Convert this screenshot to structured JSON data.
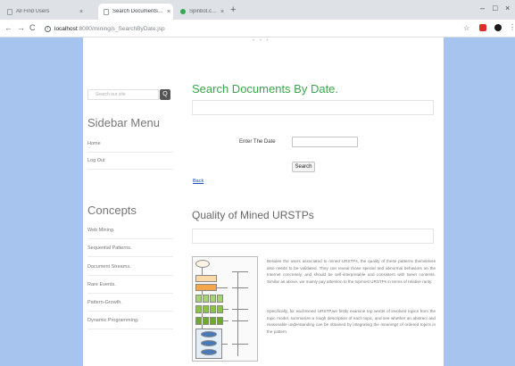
{
  "browser": {
    "tabs": [
      {
        "title": "All Find Users",
        "active": false,
        "favicon": "page-icon"
      },
      {
        "title": "Search Documents By Date",
        "active": true,
        "favicon": "page-icon"
      },
      {
        "title": "Spinbot.com - Article Spinning",
        "active": false,
        "favicon": "spinbot-icon"
      }
    ],
    "tab_close": "×",
    "new_tab": "+",
    "window_controls": {
      "minimize": "–",
      "maximize": "□",
      "close": "×"
    },
    "nav": {
      "back": "←",
      "forward": "→",
      "reload": "C"
    },
    "address": {
      "host": "localhost",
      "path": ":8000/mining/s_SearchByDate.jsp"
    },
    "star": "☆",
    "kebab": "⋮"
  },
  "page": {
    "top_dots": "• • •",
    "sidebar": {
      "search_placeholder": "Search our site",
      "search_icon": "Q",
      "menu_title": "Sidebar Menu",
      "menu_items": [
        {
          "label": "Home"
        },
        {
          "label": "Log Out"
        }
      ],
      "concepts_title": "Concepts",
      "concept_items": [
        {
          "label": "Web Mining."
        },
        {
          "label": "Sequential Patterns."
        },
        {
          "label": "Document Streams."
        },
        {
          "label": "Rare Events."
        },
        {
          "label": "Pattern-Growth."
        },
        {
          "label": "Dynamic Programming."
        }
      ]
    },
    "main": {
      "title": "Search Documents By Date.",
      "date_label": "Enter The Date",
      "date_value": "",
      "submit_label": "Search",
      "back_link": "Back",
      "section_title": "Quality of Mined URSTPs",
      "paragraph1": "Besides the users associated to mined URSTPs, the quality of these patterns themselves also needs to be validated. They can reveal those special and abnormal behaviors on the Internet concretely, and should be self-interpretable and consistent with tweet contents. Similar as above, we mainly pay attention to the topmost URSTPs in terms of relative rarity.",
      "paragraph2": "Specifically, for eachmined URSTP,we firstly examine top words of involved topics from the topic model, summarize a rough description of each topic, and see whether an abstract and reasonable understanding can be obtained by integrating the meanings of ordered topics in the pattern."
    }
  },
  "colors": {
    "page_background": "#a7c4ee",
    "title_green": "#3aa84a",
    "link_blue": "#1a4fb4",
    "figure_orange": "#f4a64b",
    "figure_green": "#8bc34a",
    "figure_blue": "#4a79b8"
  }
}
